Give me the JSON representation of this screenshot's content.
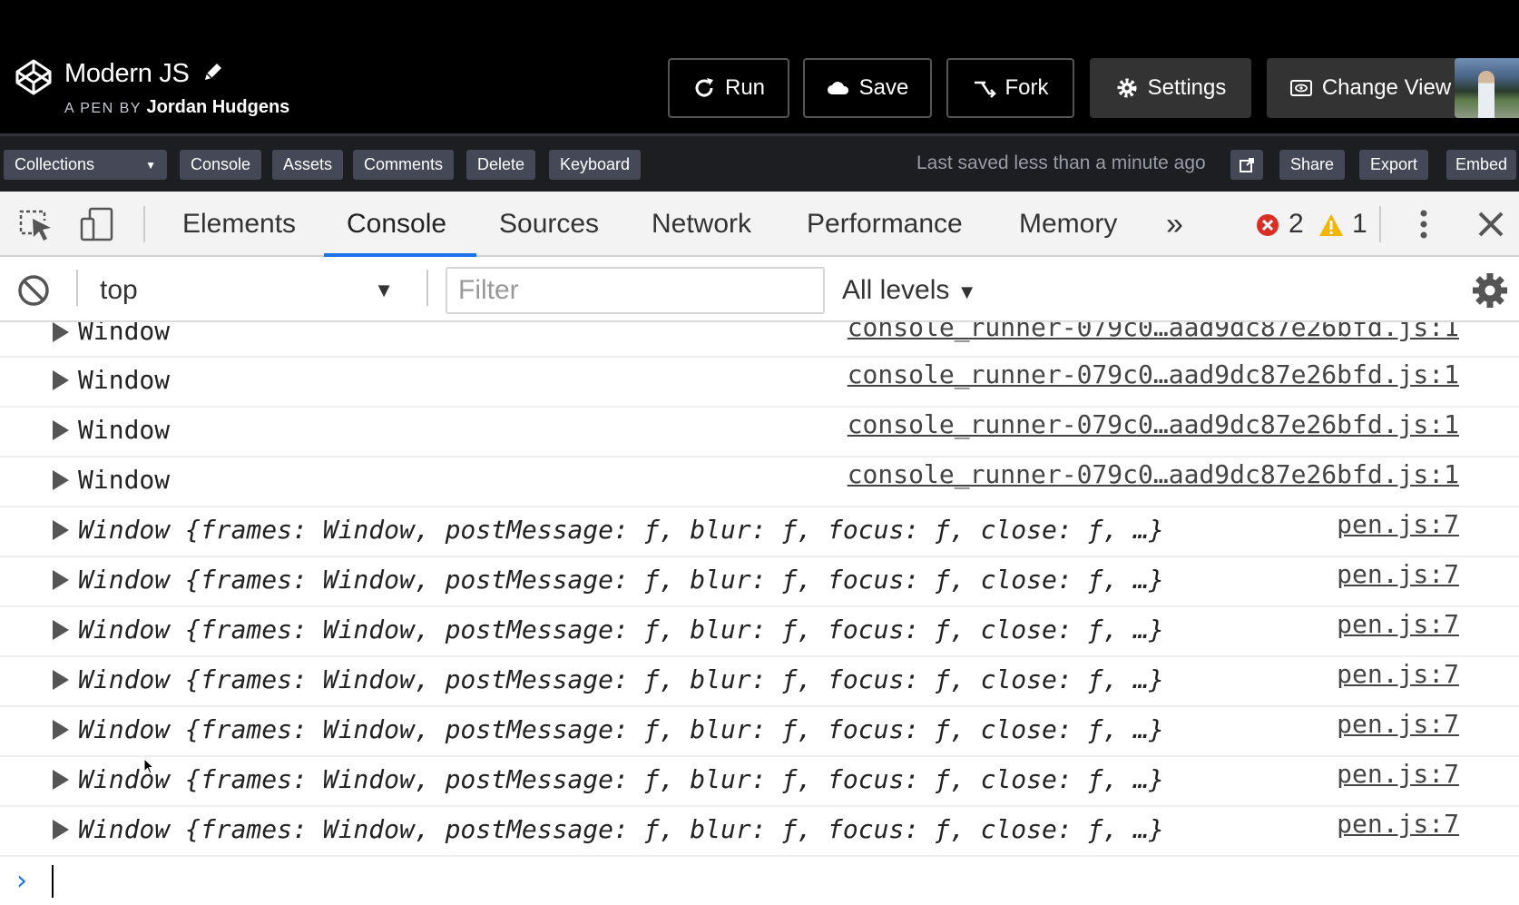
{
  "header": {
    "pen_title": "Modern JS",
    "byline_prefix": "A PEN BY",
    "author": "Jordan Hudgens",
    "buttons": {
      "run": "Run",
      "save": "Save",
      "fork": "Fork",
      "settings": "Settings",
      "change_view": "Change View"
    }
  },
  "toolbar": {
    "collections": "Collections",
    "console": "Console",
    "assets": "Assets",
    "comments": "Comments",
    "delete": "Delete",
    "keyboard": "Keyboard",
    "saved_status": "Last saved less than a minute ago",
    "share": "Share",
    "export": "Export",
    "embed": "Embed"
  },
  "devtools": {
    "tabs": [
      "Elements",
      "Console",
      "Sources",
      "Network",
      "Performance",
      "Memory"
    ],
    "active_tab": "Console",
    "more_tabs": "»",
    "error_count": "2",
    "warning_count": "1"
  },
  "console_toolbar": {
    "context": "top",
    "filter_placeholder": "Filter",
    "levels": "All levels"
  },
  "messages": [
    {
      "text": "Window",
      "source": "console_runner-079c0…aad9dc87e26bfd.js:1",
      "italic": false
    },
    {
      "text": "Window",
      "source": "console_runner-079c0…aad9dc87e26bfd.js:1",
      "italic": false
    },
    {
      "text": "Window",
      "source": "console_runner-079c0…aad9dc87e26bfd.js:1",
      "italic": false
    },
    {
      "text": "Window",
      "source": "console_runner-079c0…aad9dc87e26bfd.js:1",
      "italic": false
    },
    {
      "text": "Window {frames: Window, postMessage: ƒ, blur: ƒ, focus: ƒ, close: ƒ, …}",
      "source": "pen.js:7",
      "italic": true
    },
    {
      "text": "Window {frames: Window, postMessage: ƒ, blur: ƒ, focus: ƒ, close: ƒ, …}",
      "source": "pen.js:7",
      "italic": true
    },
    {
      "text": "Window {frames: Window, postMessage: ƒ, blur: ƒ, focus: ƒ, close: ƒ, …}",
      "source": "pen.js:7",
      "italic": true
    },
    {
      "text": "Window {frames: Window, postMessage: ƒ, blur: ƒ, focus: ƒ, close: ƒ, …}",
      "source": "pen.js:7",
      "italic": true
    },
    {
      "text": "Window {frames: Window, postMessage: ƒ, blur: ƒ, focus: ƒ, close: ƒ, …}",
      "source": "pen.js:7",
      "italic": true
    },
    {
      "text": "Window {frames: Window, postMessage: ƒ, blur: ƒ, focus: ƒ, close: ƒ, …}",
      "source": "pen.js:7",
      "italic": true
    },
    {
      "text": "Window {frames: Window, postMessage: ƒ, blur: ƒ, focus: ƒ, close: ƒ, …}",
      "source": "pen.js:7",
      "italic": true
    }
  ],
  "prompt_symbol": "›",
  "colors": {
    "header_bg": "#000000",
    "toolbar_bg": "#1d1e22",
    "toolbar_button": "#444857",
    "devtools_accent": "#1a73e8",
    "error_red": "#d93025",
    "warning_amber": "#f4b400"
  },
  "icons": [
    "codepen-logo-icon",
    "pencil-icon",
    "refresh-icon",
    "cloud-icon",
    "fork-icon",
    "gear-icon",
    "eye-window-icon",
    "external-link-icon",
    "inspect-element-icon",
    "device-toggle-icon",
    "error-icon",
    "warning-icon",
    "kebab-menu-icon",
    "close-icon",
    "clear-console-icon",
    "console-settings-icon",
    "prompt-chevron-icon"
  ]
}
